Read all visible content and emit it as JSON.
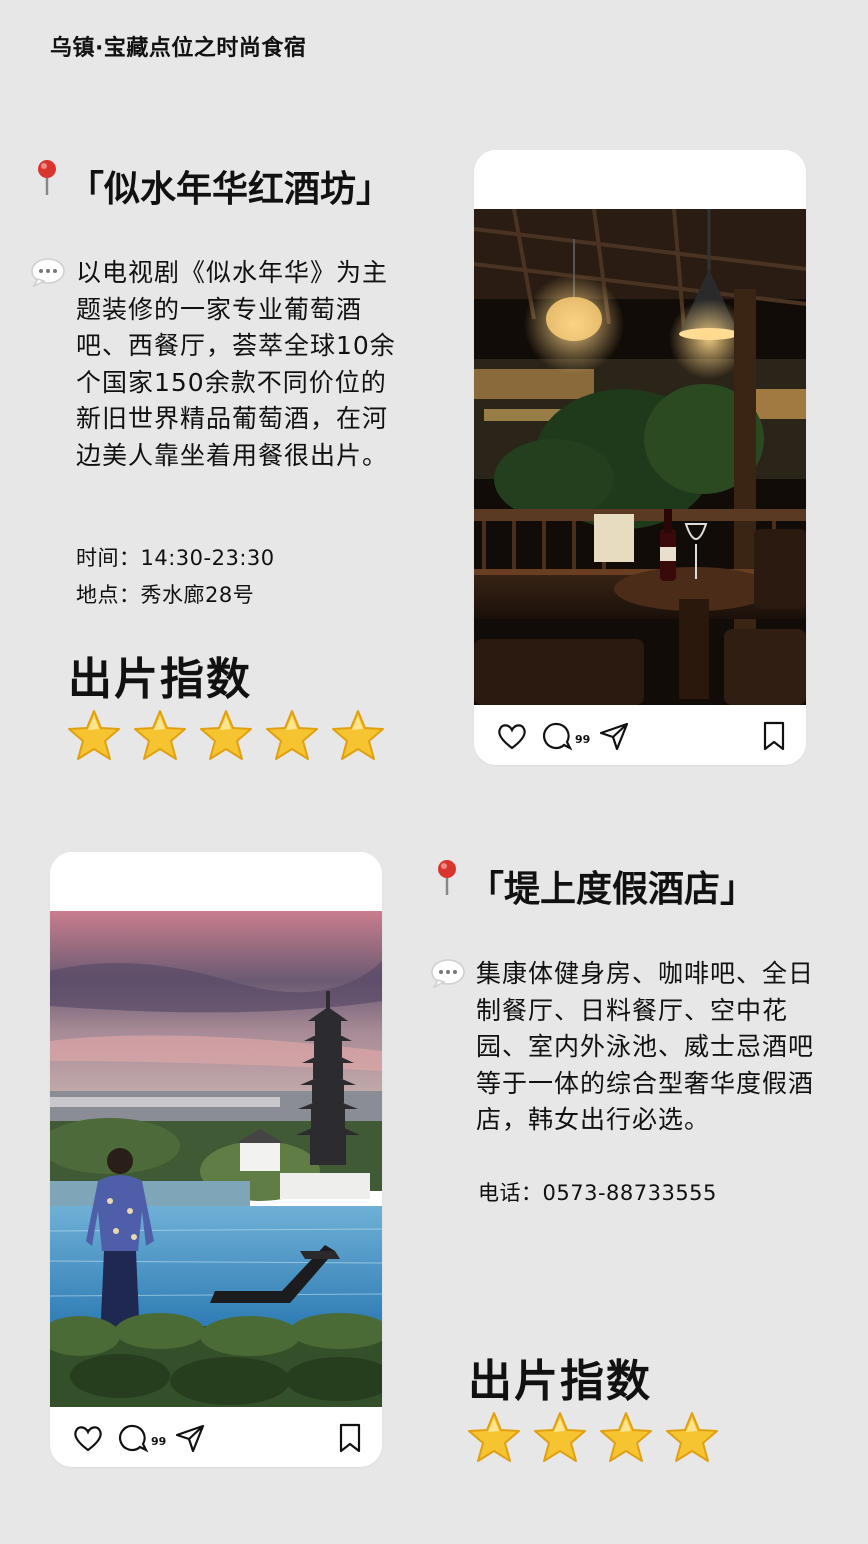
{
  "page_title": "乌镇·宝藏点位之时尚食宿",
  "spots": [
    {
      "name": "「似水年华红酒坊」",
      "description": "以电视剧《似水年华》为主题装修的一家专业葡萄酒吧、西餐厅，荟萃全球10余个国家150余款不同价位的新旧世界精品葡萄酒，在河边美人靠坐着用餐很出片。",
      "meta": [
        "时间：14:30-23:30",
        "地点：秀水廊28号"
      ],
      "rating_label": "出片指数",
      "rating_stars": 5
    },
    {
      "name": "「堤上度假酒店」",
      "description": "集康体健身房、咖啡吧、全日制餐厅、日料餐厅、空中花园、室内外泳池、威士忌酒吧等于一体的综合型奢华度假酒店，韩女出行必选。",
      "meta": [
        "电话：0573-88733555"
      ],
      "rating_label": "出片指数",
      "rating_stars": 4
    }
  ],
  "post_card": {
    "comment_count": "99",
    "icons": [
      "heart-icon",
      "comment-icon",
      "share-icon",
      "bookmark-icon"
    ]
  },
  "colors": {
    "background": "#e7e7e7",
    "card": "#ffffff",
    "star": "#f6c431",
    "pin": "#d8352e"
  }
}
